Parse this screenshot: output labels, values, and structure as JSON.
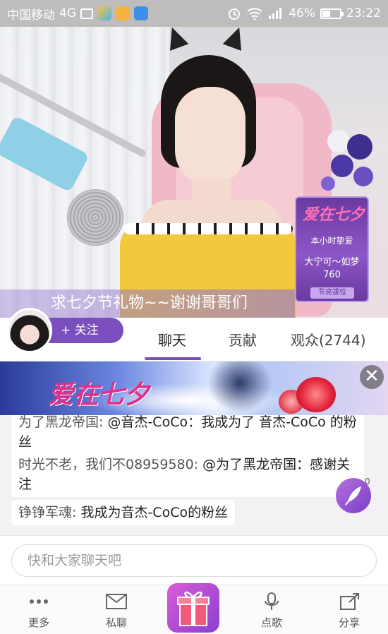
{
  "status_bar": {
    "carrier": "中国移动",
    "network": "4G",
    "battery_percent_text": "46%",
    "battery_level": 0.46,
    "time": "23:22",
    "icons": [
      "image-icon",
      "app-icon-1",
      "app-icon-2",
      "app-icon-3",
      "alarm-icon",
      "wifi-icon",
      "signal-icon",
      "battery-icon"
    ]
  },
  "stream": {
    "caption": "求七夕节礼物~~谢谢哥哥们"
  },
  "promo": {
    "logo_text": "爱在七夕",
    "title": "本小时挚爱",
    "name": "大宁可～如梦",
    "score": "760",
    "button": "节亮拔位"
  },
  "host": {
    "follow_label": "+ 关注"
  },
  "tabs": [
    {
      "label": "聊天",
      "active": true
    },
    {
      "label": "贡献",
      "active": false
    },
    {
      "label": "观众(2744)",
      "active": false
    }
  ],
  "ad": {
    "title": "爱在七夕",
    "close_symbol": "✕"
  },
  "chat": {
    "messages": [
      {
        "user": "为了黑龙帝国:",
        "text": "@音杰-CoCo：我成为了 音杰-CoCo 的粉丝"
      },
      {
        "user": "时光不老，我们不08959580:",
        "text": "@为了黑龙帝国：感谢关注"
      },
      {
        "user": "铮铮军魂:",
        "text": "我成为音杰-CoCo的粉丝"
      }
    ],
    "fab_count": "0"
  },
  "input": {
    "placeholder": "快和大家聊天吧"
  },
  "bottom_nav": [
    {
      "label": "更多",
      "icon": "more-dots-icon"
    },
    {
      "label": "私聊",
      "icon": "mail-icon"
    },
    {
      "label": "",
      "icon": "gift-icon"
    },
    {
      "label": "点歌",
      "icon": "microphone-icon"
    },
    {
      "label": "分享",
      "icon": "share-icon"
    }
  ],
  "colors": {
    "accent": "#7a4fbd",
    "status_bar": "#bfbcbc"
  }
}
